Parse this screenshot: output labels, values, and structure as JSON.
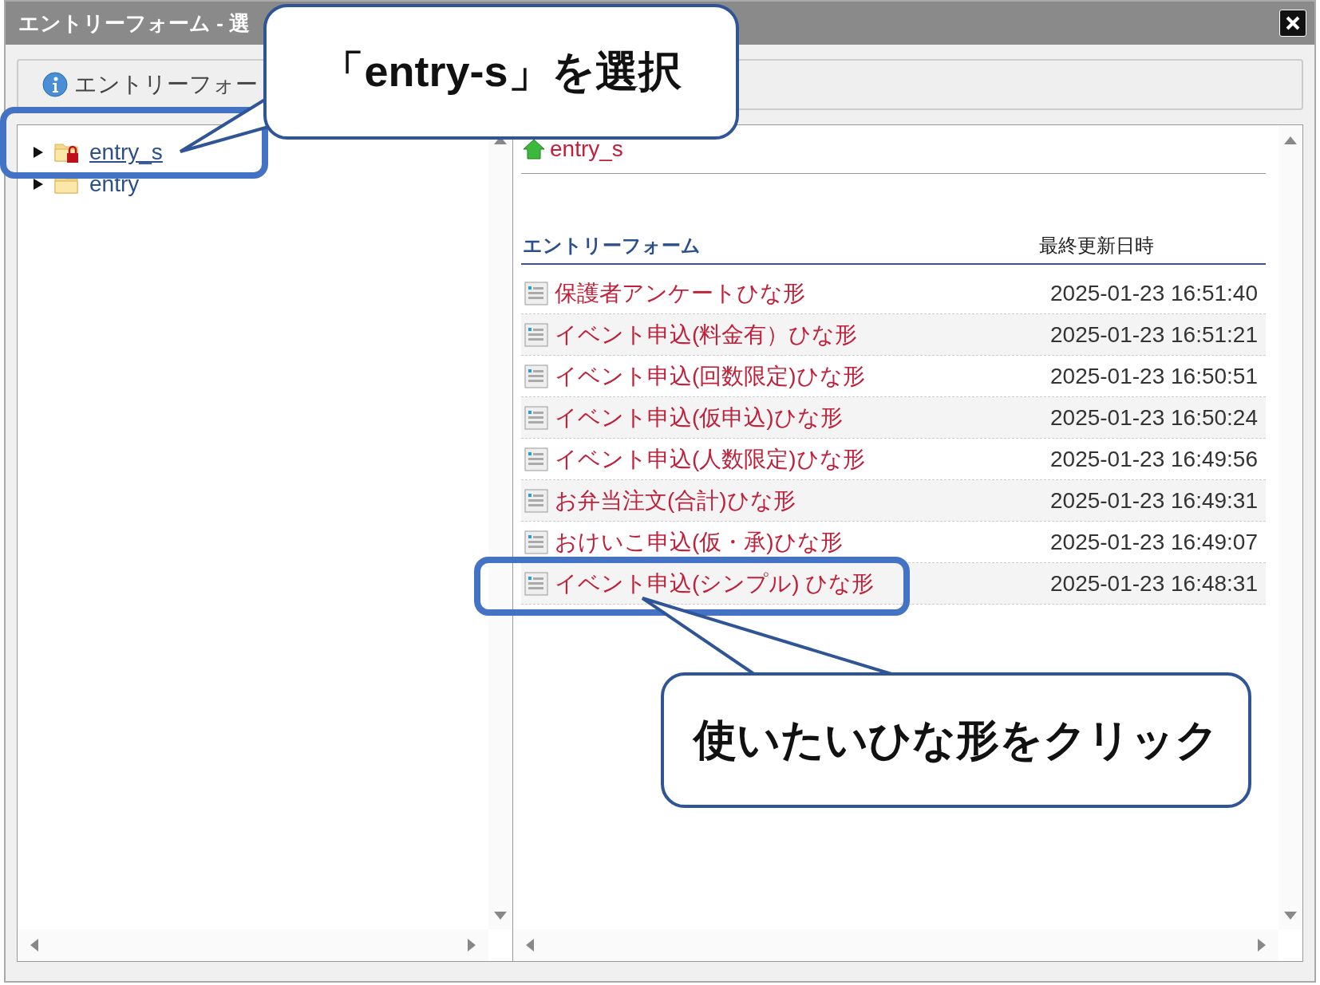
{
  "window": {
    "title": "エントリーフォーム - 選"
  },
  "tabs": [
    {
      "label": "エントリーフォー",
      "selected": true
    }
  ],
  "tree": [
    {
      "label": "entry_s",
      "selected": true,
      "expanded": false,
      "locked": true
    },
    {
      "label": "entry",
      "selected": false,
      "expanded": false,
      "locked": false
    }
  ],
  "breadcrumb": {
    "label": "entry_s"
  },
  "table": {
    "columns": [
      "エントリーフォーム",
      "最終更新日時"
    ],
    "rows": [
      {
        "name": "保護者アンケートひな形",
        "updated": "2025-01-23 16:51:40"
      },
      {
        "name": "イベント申込(料金有）ひな形",
        "updated": "2025-01-23 16:51:21"
      },
      {
        "name": "イベント申込(回数限定)ひな形",
        "updated": "2025-01-23 16:50:51"
      },
      {
        "name": "イベント申込(仮申込)ひな形",
        "updated": "2025-01-23 16:50:24"
      },
      {
        "name": "イベント申込(人数限定)ひな形",
        "updated": "2025-01-23 16:49:56"
      },
      {
        "name": "お弁当注文(合計)ひな形",
        "updated": "2025-01-23 16:49:31"
      },
      {
        "name": "おけいこ申込(仮・承)ひな形",
        "updated": "2025-01-23 16:49:07"
      },
      {
        "name": "イベント申込(シンプル) ひな形",
        "updated": "2025-01-23 16:48:31"
      }
    ]
  },
  "annotations": [
    {
      "text": "「entry-s」を選択"
    },
    {
      "text": "使いたいひな形をクリック"
    }
  ]
}
